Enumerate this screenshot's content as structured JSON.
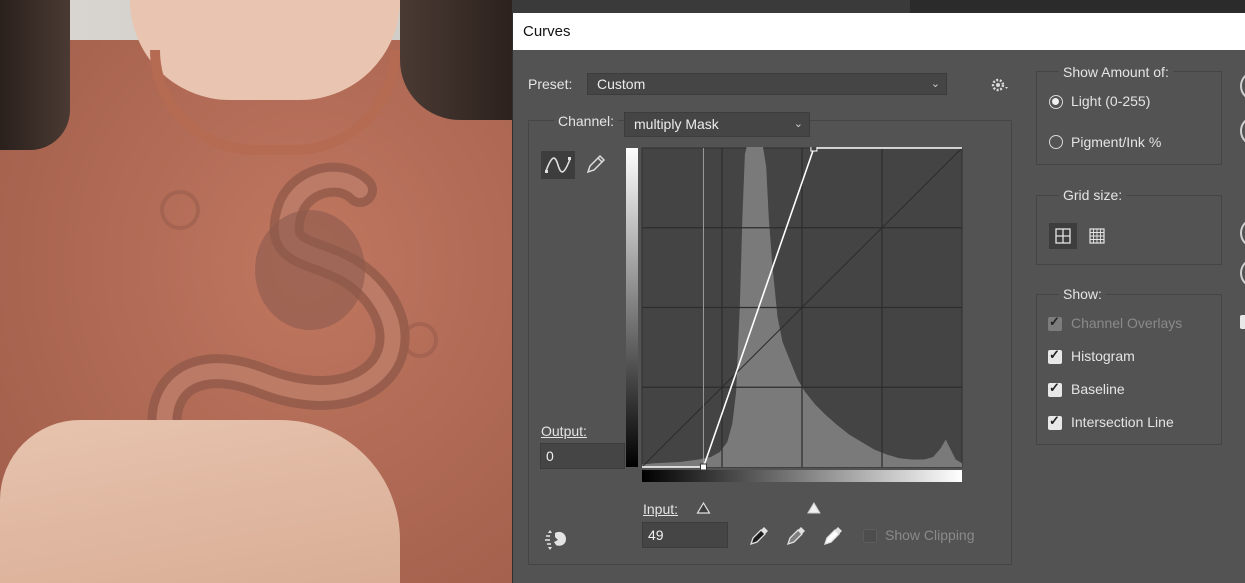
{
  "dialog": {
    "title": "Curves"
  },
  "preset": {
    "label": "Preset:",
    "value": "Custom"
  },
  "channel": {
    "label": "Channel:",
    "value": "multiply Mask"
  },
  "output": {
    "label": "Output:",
    "value": "0"
  },
  "input": {
    "label": "Input:",
    "value": "49"
  },
  "show_clipping": {
    "label": "Show Clipping",
    "checked": false,
    "enabled": false
  },
  "show_amount": {
    "legend": "Show Amount of:",
    "options": [
      {
        "label": "Light  (0-255)",
        "selected": true
      },
      {
        "label": "Pigment/Ink %",
        "selected": false
      }
    ]
  },
  "grid_size": {
    "legend": "Grid size:",
    "selected": "quarter"
  },
  "show": {
    "legend": "Show:",
    "items": [
      {
        "label": "Channel Overlays",
        "checked": true,
        "enabled": false
      },
      {
        "label": "Histogram",
        "checked": true,
        "enabled": true
      },
      {
        "label": "Baseline",
        "checked": true,
        "enabled": true
      },
      {
        "label": "Intersection Line",
        "checked": true,
        "enabled": true
      }
    ]
  },
  "curve": {
    "points": [
      {
        "input": 49,
        "output": 0
      },
      {
        "input": 137,
        "output": 255
      }
    ],
    "black_slider": 49,
    "white_slider": 137
  },
  "colors": {
    "dialog_bg": "#535353",
    "graph_bg": "#444444",
    "histogram": "#7a7a7a",
    "curve": "#ffffff"
  }
}
